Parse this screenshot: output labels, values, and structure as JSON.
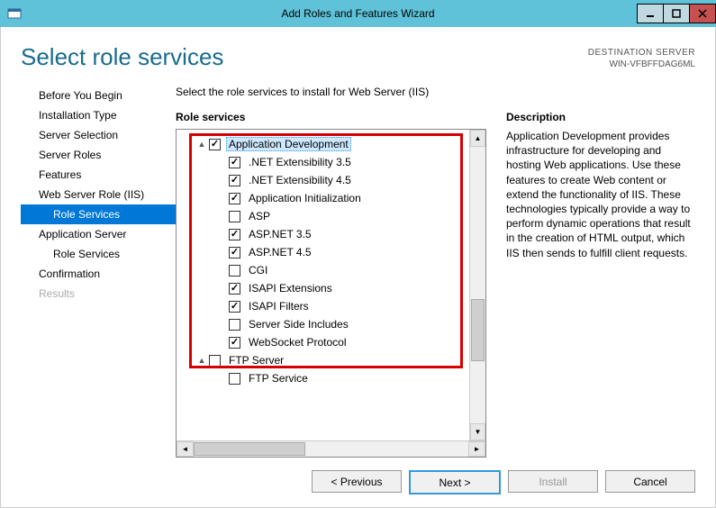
{
  "window": {
    "title": "Add Roles and Features Wizard"
  },
  "header": {
    "page_title": "Select role services",
    "dest_label": "DESTINATION SERVER",
    "dest_value": "WIN-VFBFFDAG6ML"
  },
  "nav": {
    "items": [
      {
        "label": "Before You Begin",
        "indent": false,
        "selected": false,
        "disabled": false
      },
      {
        "label": "Installation Type",
        "indent": false,
        "selected": false,
        "disabled": false
      },
      {
        "label": "Server Selection",
        "indent": false,
        "selected": false,
        "disabled": false
      },
      {
        "label": "Server Roles",
        "indent": false,
        "selected": false,
        "disabled": false
      },
      {
        "label": "Features",
        "indent": false,
        "selected": false,
        "disabled": false
      },
      {
        "label": "Web Server Role (IIS)",
        "indent": false,
        "selected": false,
        "disabled": false
      },
      {
        "label": "Role Services",
        "indent": true,
        "selected": true,
        "disabled": false
      },
      {
        "label": "Application Server",
        "indent": false,
        "selected": false,
        "disabled": false
      },
      {
        "label": "Role Services",
        "indent": true,
        "selected": false,
        "disabled": false
      },
      {
        "label": "Confirmation",
        "indent": false,
        "selected": false,
        "disabled": false
      },
      {
        "label": "Results",
        "indent": false,
        "selected": false,
        "disabled": true
      }
    ]
  },
  "content": {
    "instruction": "Select the role services to install for Web Server (IIS)",
    "roles_title": "Role services",
    "desc_title": "Description",
    "desc_text": "Application Development provides infrastructure for developing and hosting Web applications. Use these features to create Web content or extend the functionality of IIS. These technologies typically provide a way to perform dynamic operations that result in the creation of HTML output, which IIS then sends to fulfill client requests."
  },
  "tree": {
    "rows": [
      {
        "indent": 0,
        "expander": "▲",
        "checked": true,
        "label": "Application Development",
        "selected": true
      },
      {
        "indent": 1,
        "expander": "",
        "checked": true,
        "label": ".NET Extensibility 3.5",
        "selected": false
      },
      {
        "indent": 1,
        "expander": "",
        "checked": true,
        "label": ".NET Extensibility 4.5",
        "selected": false
      },
      {
        "indent": 1,
        "expander": "",
        "checked": true,
        "label": "Application Initialization",
        "selected": false
      },
      {
        "indent": 1,
        "expander": "",
        "checked": false,
        "label": "ASP",
        "selected": false
      },
      {
        "indent": 1,
        "expander": "",
        "checked": true,
        "label": "ASP.NET 3.5",
        "selected": false
      },
      {
        "indent": 1,
        "expander": "",
        "checked": true,
        "label": "ASP.NET 4.5",
        "selected": false
      },
      {
        "indent": 1,
        "expander": "",
        "checked": false,
        "label": "CGI",
        "selected": false
      },
      {
        "indent": 1,
        "expander": "",
        "checked": true,
        "label": "ISAPI Extensions",
        "selected": false
      },
      {
        "indent": 1,
        "expander": "",
        "checked": true,
        "label": "ISAPI Filters",
        "selected": false
      },
      {
        "indent": 1,
        "expander": "",
        "checked": false,
        "label": "Server Side Includes",
        "selected": false
      },
      {
        "indent": 1,
        "expander": "",
        "checked": true,
        "label": "WebSocket Protocol",
        "selected": false
      },
      {
        "indent": 0,
        "expander": "▲",
        "checked": false,
        "label": "FTP Server",
        "selected": false
      },
      {
        "indent": 1,
        "expander": "",
        "checked": false,
        "label": "FTP Service",
        "selected": false
      }
    ]
  },
  "buttons": {
    "previous": "< Previous",
    "next": "Next >",
    "install": "Install",
    "cancel": "Cancel"
  }
}
